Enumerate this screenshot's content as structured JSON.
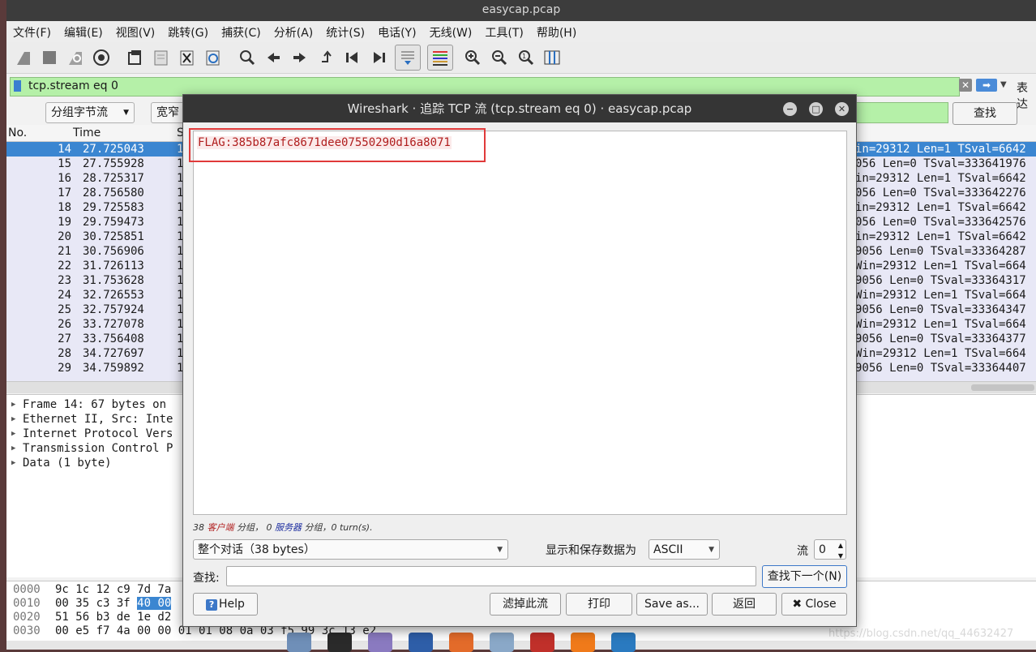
{
  "window": {
    "title": "easycap.pcap"
  },
  "menu": [
    "文件(F)",
    "编辑(E)",
    "视图(V)",
    "跳转(G)",
    "捕获(C)",
    "分析(A)",
    "统计(S)",
    "电话(Y)",
    "无线(W)",
    "工具(T)",
    "帮助(H)"
  ],
  "filter": {
    "value": "tcp.stream eq 0",
    "clear": "✕",
    "apply": "➡",
    "expression_label": "表达"
  },
  "findbar": {
    "mode_select": "分组字节流",
    "width_select": "宽窄",
    "find_button": "查找"
  },
  "packet_list": {
    "columns": [
      "No.",
      "Time",
      "S"
    ],
    "rows": [
      {
        "no": "14",
        "time": "27.725043",
        "s": "1",
        "info": "in=29312 Len=1 TSval=6642",
        "selected": true
      },
      {
        "no": "15",
        "time": "27.755928",
        "s": "1",
        "info": "056 Len=0 TSval=333641976"
      },
      {
        "no": "16",
        "time": "28.725317",
        "s": "1",
        "info": "in=29312 Len=1 TSval=6642"
      },
      {
        "no": "17",
        "time": "28.756580",
        "s": "1",
        "info": "056 Len=0 TSval=333642276"
      },
      {
        "no": "18",
        "time": "29.725583",
        "s": "1",
        "info": "in=29312 Len=1 TSval=6642"
      },
      {
        "no": "19",
        "time": "29.759473",
        "s": "1",
        "info": "056 Len=0 TSval=333642576"
      },
      {
        "no": "20",
        "time": "30.725851",
        "s": "1",
        "info": "in=29312 Len=1 TSval=6642"
      },
      {
        "no": "21",
        "time": "30.756906",
        "s": "1",
        "info": "9056 Len=0 TSval=33364287"
      },
      {
        "no": "22",
        "time": "31.726113",
        "s": "1",
        "info": "Win=29312 Len=1 TSval=664"
      },
      {
        "no": "23",
        "time": "31.753628",
        "s": "1",
        "info": "9056 Len=0 TSval=33364317"
      },
      {
        "no": "24",
        "time": "32.726553",
        "s": "1",
        "info": "Win=29312 Len=1 TSval=664"
      },
      {
        "no": "25",
        "time": "32.757924",
        "s": "1",
        "info": "9056 Len=0 TSval=33364347"
      },
      {
        "no": "26",
        "time": "33.727078",
        "s": "1",
        "info": "Win=29312 Len=1 TSval=664"
      },
      {
        "no": "27",
        "time": "33.756408",
        "s": "1",
        "info": "9056 Len=0 TSval=33364377"
      },
      {
        "no": "28",
        "time": "34.727697",
        "s": "1",
        "info": "Win=29312 Len=1 TSval=664"
      },
      {
        "no": "29",
        "time": "34.759892",
        "s": "1",
        "info": "9056 Len=0 TSval=33364407"
      }
    ]
  },
  "details": [
    "Frame 14: 67 bytes on",
    "Ethernet II, Src: Inte",
    "Internet Protocol Vers",
    "Transmission Control P",
    "Data (1 byte)"
  ],
  "bytes": [
    {
      "off": "0000",
      "pre": "9c 1c 12 c9 7d 7a",
      "hl": "",
      "post": ""
    },
    {
      "off": "0010",
      "pre": "00 35 c3 3f ",
      "hl": "40 00",
      "post": ""
    },
    {
      "off": "0020",
      "pre": "51 56 b3 de 1e d2",
      "hl": "",
      "post": ""
    },
    {
      "off": "0030",
      "pre": "00 e5 f7 4a 00 00 01 01  08 0a 03 f5 99 3c 13 e2",
      "hl": "",
      "post": ""
    }
  ],
  "watermark": "https://blog.csdn.net/qq_44632427",
  "dialog": {
    "title": "Wireshark · 追踪 TCP 流 (tcp.stream eq 0) · easycap.pcap",
    "stream_text": "FLAG:385b87afc8671dee07550290d16a8071",
    "stats": {
      "client_count": "38",
      "client_label": "客户端",
      "group1": "分组，",
      "server_count": "0",
      "server_label": "服务器",
      "group2": "分组，0 turn(s)."
    },
    "conversation_select": "整个对话（38 bytes）",
    "show_save_label": "显示和保存数据为",
    "format_select": "ASCII",
    "stream_label": "流",
    "stream_number": "0",
    "find_label": "查找:",
    "find_next": "查找下一个(N)",
    "help": "Help",
    "filter_out": "滤掉此流",
    "print": "打印",
    "save_as": "Save as...",
    "back": "返回",
    "close": "Close"
  }
}
